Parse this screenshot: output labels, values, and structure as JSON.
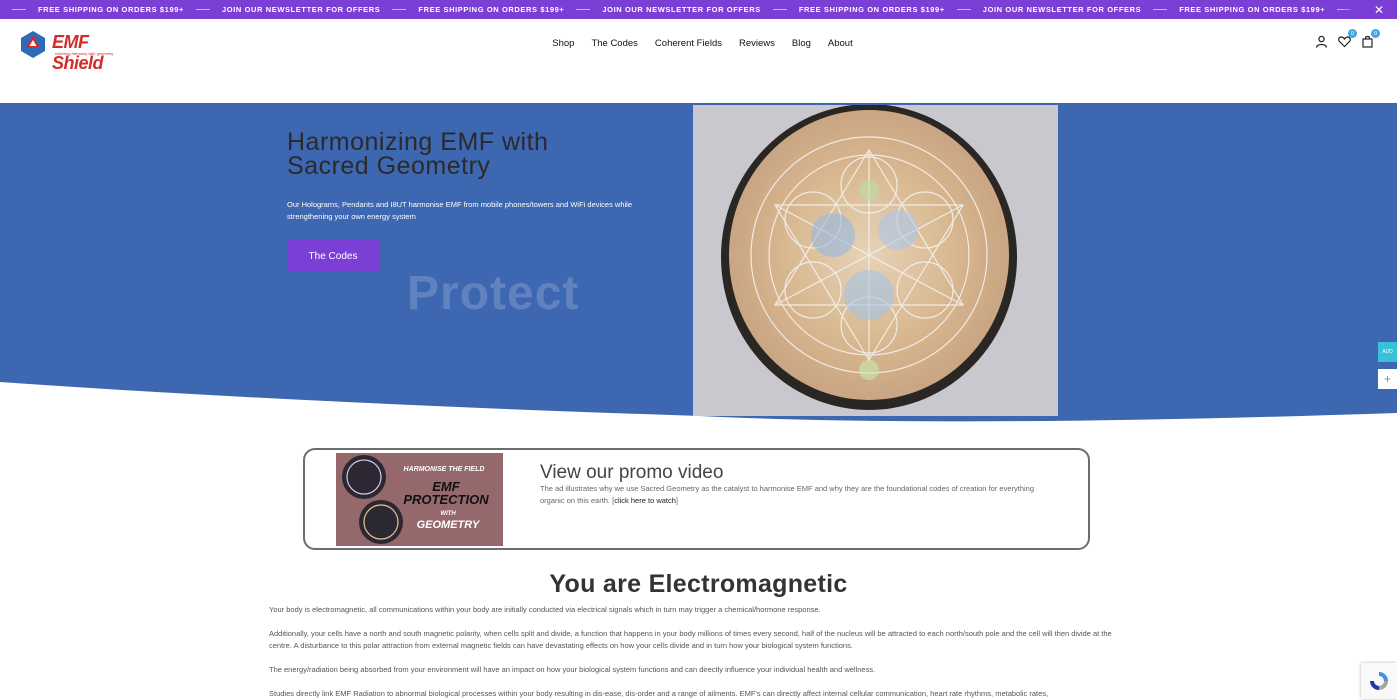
{
  "announcement": {
    "items": [
      "FREE SHIPPING ON ORDERS $199+",
      "JOIN OUR NEWSLETTER FOR OFFERS",
      "FREE SHIPPING ON ORDERS $199+",
      "JOIN OUR NEWSLETTER FOR OFFERS",
      "FREE SHIPPING ON ORDERS $199+",
      "JOIN OUR NEWSLETTER FOR OFFERS",
      "FREE SHIPPING ON ORDERS $199+",
      "JOIN OUR NEWSLETTER FOR OFFERS",
      "FREE SHIPPING ON ORDERS $199+"
    ],
    "close_icon": "close-icon",
    "color": "#7b3fd6"
  },
  "header": {
    "logo_text": "EMF Shield",
    "logo_tagline": "restoring harmony with geometry",
    "nav": [
      "Shop",
      "The Codes",
      "Coherent Fields",
      "Reviews",
      "Blog",
      "About"
    ],
    "wishlist_count": "0",
    "cart_count": "0"
  },
  "hero": {
    "title": "Harmonizing EMF with Sacred Geometry",
    "text": "Our Holograms, Pendants and I8UT harmonise EMF from mobile phones/towers and WiFi devices while strengthening your own energy system",
    "button_label": "The Codes",
    "ghost_text": "Protect",
    "bg_color": "#3d67b0",
    "accent": "#7b3fd6"
  },
  "side": {
    "currency": "AUD"
  },
  "promo": {
    "title": "View our promo video",
    "text": "The ad illustrates why we use Sacred Geometry as the catalyst to harmonise EMF and why they are the foundational codes of creation for everything organic on this earth. [",
    "link": "click here to watch",
    "text_end": "]",
    "image_text": {
      "line1": "HARMONISE THE FIELD",
      "line2": "EMF",
      "line3": "PROTECTION",
      "line4": "WITH",
      "line5": "GEOMETRY"
    }
  },
  "section": {
    "title": "You are Electromagnetic",
    "paragraphs": [
      "Your body is electromagnetic, all communications within your body are initially conducted via electrical signals which in turn may trigger a chemical/hormone response.",
      "Additionally, your cells have a north and south magnetic polarity, when cells split and divide, a function that happens in your body millions of times every second, half of the nucleus will be attracted to each north/south pole and the cell will then divide at the centre. A disturbance to this polar attraction from external magnetic fields can have devastating effects on how your cells divide and in turn how your biological system functions.",
      "The energy/radiation being absorbed from your environment will have an impact on how your biological system functions and can directly influence your individual health and wellness.",
      "Studies directly link EMF Radiation to abnormal biological processes within your body resulting in dis-ease, dis-order and a range of ailments. EMF's can directly affect internal cellular communication, heart rate rhythms, metabolic rates,"
    ]
  }
}
